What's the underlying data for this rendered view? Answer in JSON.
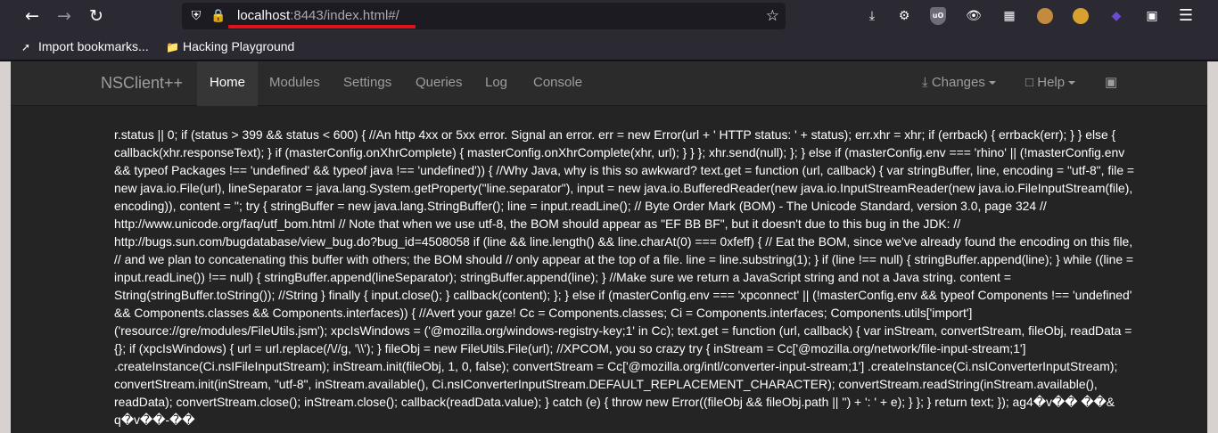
{
  "browser": {
    "url_host": "localhost",
    "url_rest": ":8443/index.html#/",
    "icons": [
      "back-arrow-icon",
      "forward-arrow-icon",
      "reload-icon",
      "shield-icon",
      "lock-icon",
      "star-icon",
      "download-icon",
      "extensions-icon",
      "ublock-icon",
      "menu-icon"
    ]
  },
  "bookmarks": [
    {
      "label": "Import bookmarks..."
    },
    {
      "label": "Hacking Playground"
    }
  ],
  "app": {
    "brand": "NSClient++",
    "nav": {
      "home": "Home",
      "modules": "Modules",
      "settings": "Settings",
      "queries": "Queries",
      "log": "Log",
      "console": "Console",
      "changes": "Changes",
      "help": "Help"
    },
    "body_text": "r.status || 0; if (status > 399 && status < 600) { //An http 4xx or 5xx error. Signal an error. err = new Error(url + ' HTTP status: ' + status); err.xhr = xhr; if (errback) { errback(err); } } else { callback(xhr.responseText); } if (masterConfig.onXhrComplete) { masterConfig.onXhrComplete(xhr, url); } } }; xhr.send(null); }; } else if (masterConfig.env === 'rhino' || (!masterConfig.env && typeof Packages !== 'undefined' && typeof java !== 'undefined')) { //Why Java, why is this so awkward? text.get = function (url, callback) { var stringBuffer, line, encoding = \"utf-8\", file = new java.io.File(url), lineSeparator = java.lang.System.getProperty(\"line.separator\"), input = new java.io.BufferedReader(new java.io.InputStreamReader(new java.io.FileInputStream(file), encoding)), content = ''; try { stringBuffer = new java.lang.StringBuffer(); line = input.readLine(); // Byte Order Mark (BOM) - The Unicode Standard, version 3.0, page 324 // http://www.unicode.org/faq/utf_bom.html // Note that when we use utf-8, the BOM should appear as \"EF BB BF\", but it doesn't due to this bug in the JDK: // http://bugs.sun.com/bugdatabase/view_bug.do?bug_id=4508058 if (line && line.length() && line.charAt(0) === 0xfeff) { // Eat the BOM, since we've already found the encoding on this file, // and we plan to concatenating this buffer with others; the BOM should // only appear at the top of a file. line = line.substring(1); } if (line !== null) { stringBuffer.append(line); } while ((line = input.readLine()) !== null) { stringBuffer.append(lineSeparator); stringBuffer.append(line); } //Make sure we return a JavaScript string and not a Java string. content = String(stringBuffer.toString()); //String } finally { input.close(); } callback(content); }; } else if (masterConfig.env === 'xpconnect' || (!masterConfig.env && typeof Components !== 'undefined' && Components.classes && Components.interfaces)) { //Avert your gaze! Cc = Components.classes; Ci = Components.interfaces; Components.utils['import']('resource://gre/modules/FileUtils.jsm'); xpcIsWindows = ('@mozilla.org/windows-registry-key;1' in Cc); text.get = function (url, callback) { var inStream, convertStream, fileObj, readData = {}; if (xpcIsWindows) { url = url.replace(/\\//g, '\\\\'); } fileObj = new FileUtils.File(url); //XPCOM, you so crazy try { inStream = Cc['@mozilla.org/network/file-input-stream;1'] .createInstance(Ci.nsIFileInputStream); inStream.init(fileObj, 1, 0, false); convertStream = Cc['@mozilla.org/intl/converter-input-stream;1'] .createInstance(Ci.nsIConverterInputStream); convertStream.init(inStream, \"utf-8\", inStream.available(), Ci.nsIConverterInputStream.DEFAULT_REPLACEMENT_CHARACTER); convertStream.readString(inStream.available(), readData); convertStream.close(); inStream.close(); callback(readData.value); } catch (e) { throw new Error((fileObj && fileObj.path || '') + ': ' + e); } }; } return text; }); ag4�v�� ��& q�v��-��"
  }
}
